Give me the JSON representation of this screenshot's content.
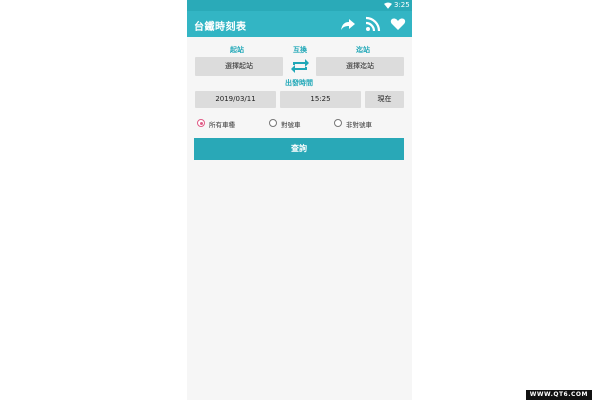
{
  "status_bar": {
    "time": "3:25",
    "wifi_icon": "wifi-icon"
  },
  "app_bar": {
    "title": "台鐵時刻表",
    "icons": [
      "share-icon",
      "rss-icon",
      "heart-icon"
    ],
    "color": "#33b5c4"
  },
  "form": {
    "from_label": "起站",
    "swap_label": "互換",
    "to_label": "迄站",
    "from_button": "選擇起站",
    "to_button": "選擇迄站",
    "time_label": "出發時間",
    "date_value": "2019/03/11",
    "time_value": "15:25",
    "now_button": "現在",
    "train_types": [
      {
        "label": "所有車種",
        "selected": true
      },
      {
        "label": "對號車",
        "selected": false
      },
      {
        "label": "非對號車",
        "selected": false
      }
    ],
    "search_button": "查詢"
  },
  "watermark": "WWW.QT6.COM",
  "colors": {
    "accent": "#1fa7b7",
    "button_bg": "#dcdcdc",
    "radio_selected": "#e05b86"
  }
}
